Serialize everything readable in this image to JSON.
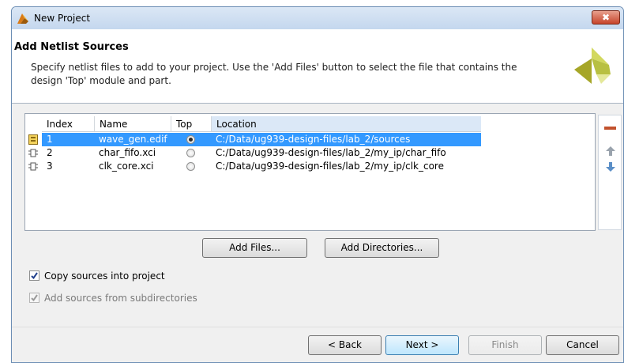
{
  "window": {
    "title": "New Project",
    "close_label": "✖"
  },
  "header": {
    "title": "Add Netlist Sources",
    "description": "Specify netlist files to add to your project. Use the 'Add Files' button to select the file that contains the design 'Top' module and part."
  },
  "table": {
    "columns": [
      "Index",
      "Name",
      "Top",
      "Location"
    ],
    "rows": [
      {
        "index": "1",
        "name": "wave_gen.edif",
        "top": true,
        "location": "C:/Data/ug939-design-files/lab_2/sources",
        "icon": "netlist-file-icon"
      },
      {
        "index": "2",
        "name": "char_fifo.xci",
        "top": false,
        "location": "C:/Data/ug939-design-files/lab_2/my_ip/char_fifo",
        "icon": "ip-core-icon"
      },
      {
        "index": "3",
        "name": "clk_core.xci",
        "top": false,
        "location": "C:/Data/ug939-design-files/lab_2/my_ip/clk_core",
        "icon": "ip-core-icon"
      }
    ]
  },
  "side_tools": [
    "remove-icon",
    "move-up-icon",
    "move-down-icon"
  ],
  "buttons": {
    "add_files": "Add Files...",
    "add_directories": "Add Directories...",
    "back": "< Back",
    "next": "Next >",
    "finish": "Finish",
    "cancel": "Cancel"
  },
  "options": {
    "copy_sources": {
      "label": "Copy sources into project",
      "checked": true
    },
    "add_subdirs": {
      "label": "Add sources from subdirectories",
      "checked": true,
      "disabled": true
    }
  },
  "colors": {
    "selection": "#3399ff",
    "remove": "#c2522d",
    "arrows": "#5b8fc7"
  }
}
